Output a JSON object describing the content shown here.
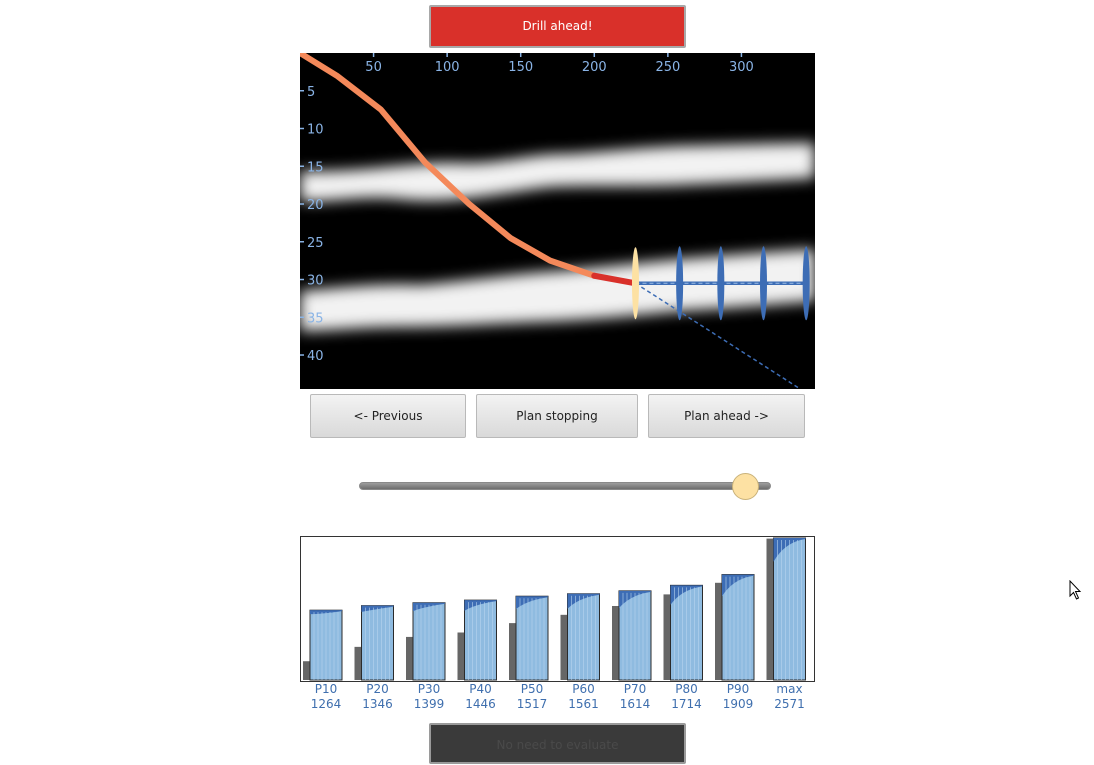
{
  "buttons": {
    "drill": "Drill ahead!",
    "previous": "<- Previous",
    "plan_stopping": "Plan stopping",
    "plan_ahead": "Plan ahead ->",
    "evaluate": "No need to evaluate"
  },
  "colors": {
    "drill_button": "#d9302a",
    "drilled_path": "#f4895a",
    "current_segment": "#d9302a",
    "plan_path": "#3d6db5",
    "current_position": "#fde1a3",
    "histogram_bar": "#8fbbe0",
    "histogram_top": "#3d6db5",
    "histogram_shadow": "#666666"
  },
  "slider": {
    "value_fraction": 0.97
  },
  "chart_data": [
    {
      "type": "heatmap",
      "title": "",
      "x_ticks": [
        50,
        100,
        150,
        200,
        250,
        300
      ],
      "y_ticks": [
        5,
        10,
        15,
        20,
        25,
        30,
        35,
        40
      ],
      "xlim": [
        0,
        350
      ],
      "ylim": [
        0,
        44.5
      ],
      "drilled_path": [
        [
          0,
          0
        ],
        [
          25,
          3
        ],
        [
          55,
          7.5
        ],
        [
          85,
          14.5
        ],
        [
          115,
          20
        ],
        [
          143,
          24.5
        ],
        [
          170,
          27.5
        ],
        [
          200,
          29.5
        ],
        [
          228,
          30.5
        ]
      ],
      "current_position": {
        "x": 228,
        "y": 30.5
      },
      "plan_points_x": [
        258,
        286,
        315,
        344
      ],
      "plan_y": 30.5,
      "plan_dashed_end": {
        "x": 340,
        "y": 44.5
      }
    },
    {
      "type": "bar",
      "categories": [
        "P10",
        "P20",
        "P30",
        "P40",
        "P50",
        "P60",
        "P70",
        "P80",
        "P90",
        "max"
      ],
      "values": [
        1264,
        1346,
        1399,
        1446,
        1517,
        1561,
        1614,
        1714,
        1909,
        2571
      ],
      "shadow_values": [
        340,
        600,
        780,
        860,
        1030,
        1180,
        1340,
        1550,
        1760,
        2560
      ]
    }
  ]
}
